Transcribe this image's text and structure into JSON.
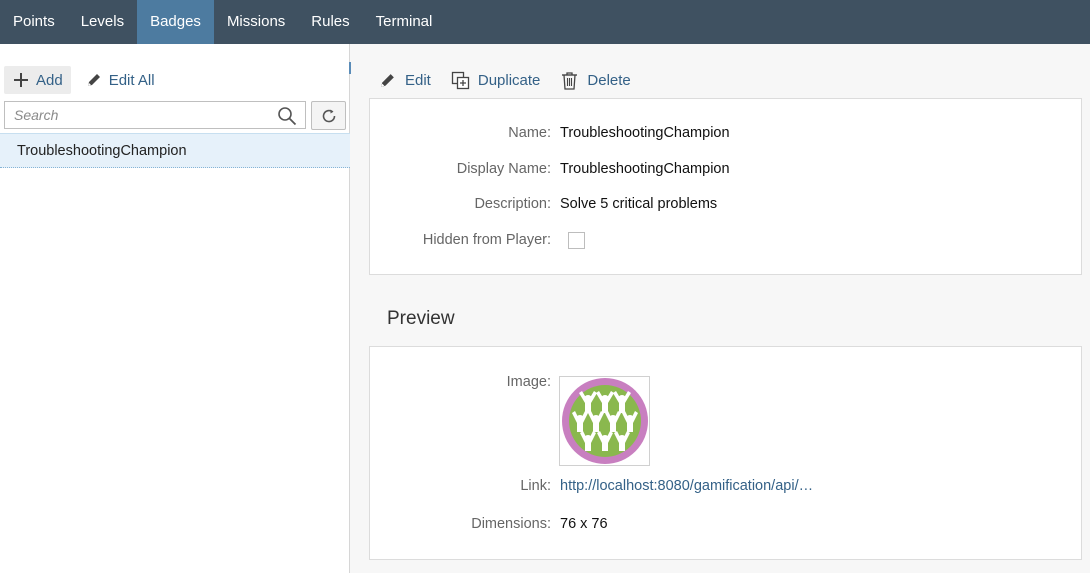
{
  "nav": {
    "tabs": [
      {
        "label": "Points"
      },
      {
        "label": "Levels"
      },
      {
        "label": "Badges",
        "active": true
      },
      {
        "label": "Missions"
      },
      {
        "label": "Rules"
      },
      {
        "label": "Terminal"
      }
    ]
  },
  "left": {
    "add_label": "Add",
    "edit_all_label": "Edit All",
    "search": {
      "placeholder": "Search",
      "value": ""
    },
    "items": [
      {
        "label": "TroubleshootingChampion",
        "selected": true
      }
    ]
  },
  "toolbar": {
    "edit_label": "Edit",
    "duplicate_label": "Duplicate",
    "delete_label": "Delete"
  },
  "details": {
    "name_label": "Name:",
    "name_value": "TroubleshootingChampion",
    "display_name_label": "Display Name:",
    "display_name_value": "TroubleshootingChampion",
    "description_label": "Description:",
    "description_value": "Solve 5 critical problems",
    "hidden_label": "Hidden from Player:",
    "hidden_checked": false
  },
  "preview": {
    "title": "Preview",
    "image_label": "Image:",
    "link_label": "Link:",
    "link_value": "http://localhost:8080/gamification/api/…",
    "dimensions_label": "Dimensions:",
    "dimensions_value": "76 x 76"
  },
  "icons": {
    "add": "plus-icon",
    "edit": "pencil-icon",
    "duplicate": "duplicate-icon",
    "delete": "trash-icon",
    "search": "search-icon",
    "refresh": "refresh-icon",
    "badge": "badge-people-icon"
  },
  "colors": {
    "nav_bg": "#3f5161",
    "nav_active": "#4d7ba0",
    "link": "#346187",
    "selected_row": "#e6f1fa",
    "badge_ring": "#c87fc0",
    "badge_fill": "#8ab84e"
  }
}
